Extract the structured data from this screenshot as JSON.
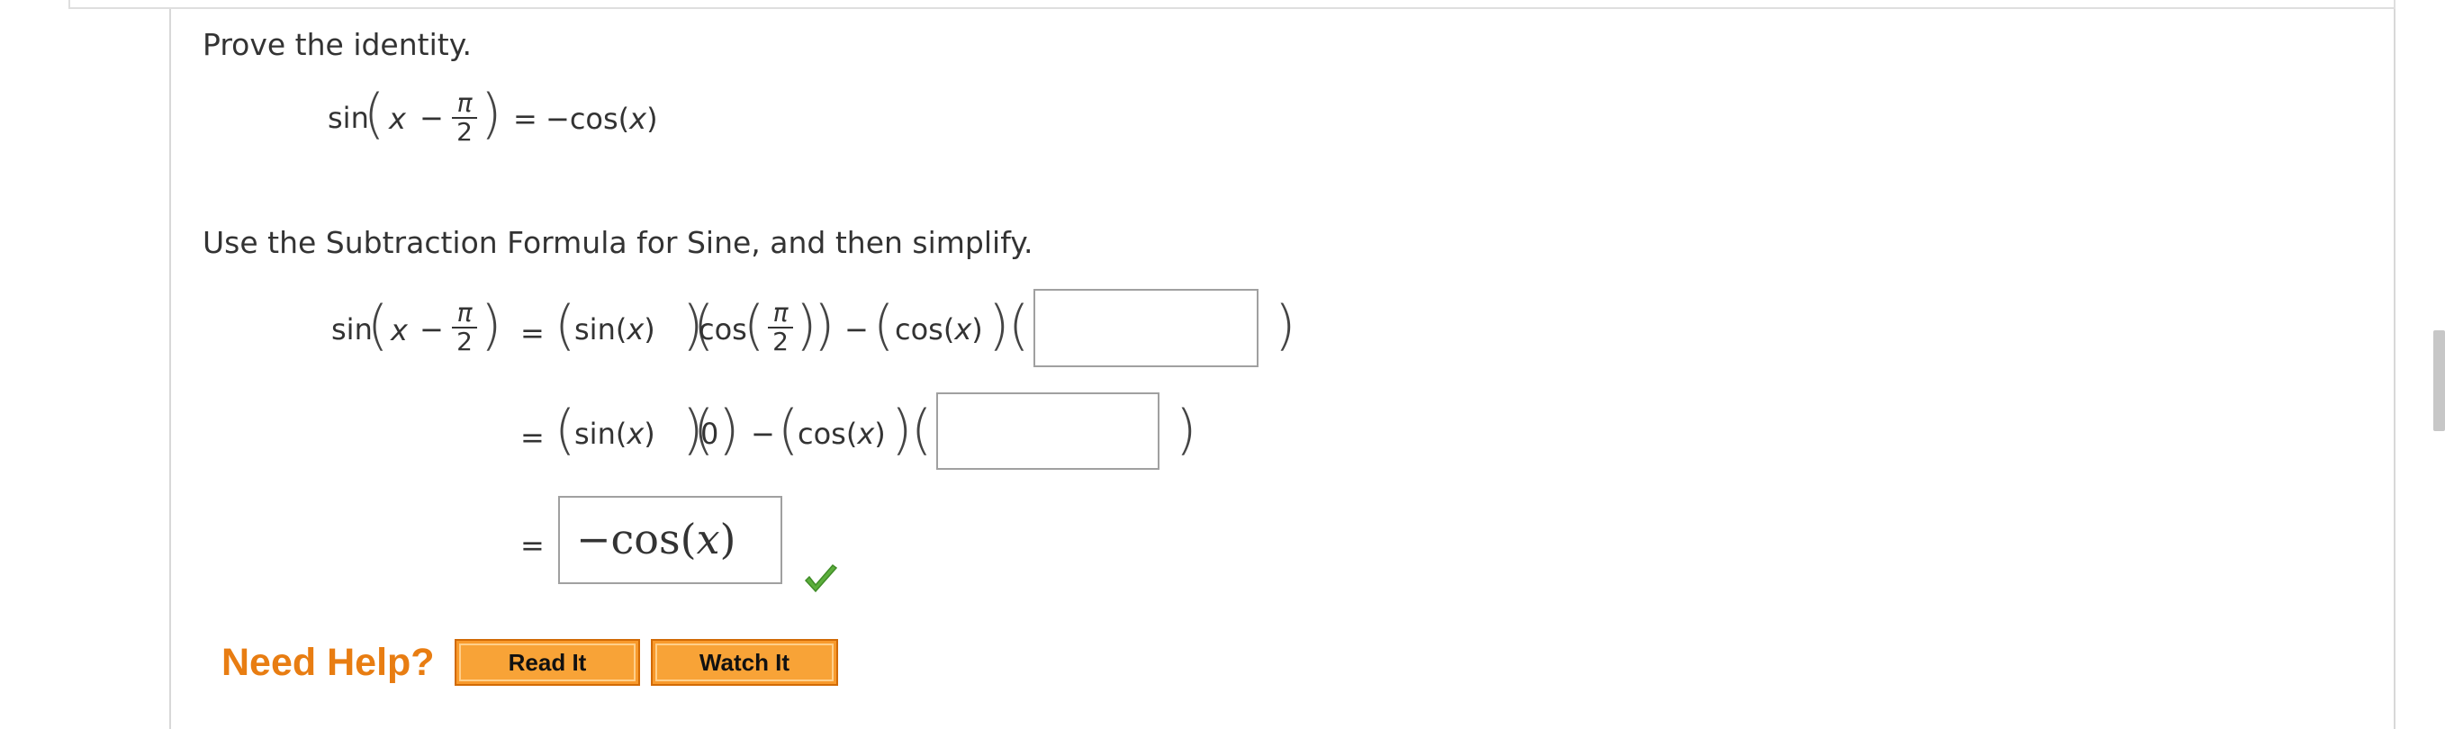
{
  "instruction": "Prove the identity.",
  "identity": {
    "sin": "sin",
    "x": "x",
    "minus": "−",
    "pi": "π",
    "two": "2",
    "equals": "=",
    "rhs_prefix": "−cos(",
    "rhs_x": "x",
    "rhs_suffix": ")"
  },
  "step_instruction": "Use the Subtraction Formula for Sine, and then simplify.",
  "line1": {
    "sin": "sin",
    "x": "x",
    "minus": "−",
    "pi": "π",
    "two": "2",
    "equals": "=",
    "sin_x_prefix": "sin(",
    "sin_x_var": "x",
    "sin_x_suffix": ")",
    "cos": "cos",
    "minus2": "−",
    "cos_x_prefix": "cos(",
    "cos_x_var": "x",
    "cos_x_suffix": ")",
    "input_value": ""
  },
  "line2": {
    "equals": "=",
    "sin_x_prefix": "sin(",
    "sin_x_var": "x",
    "sin_x_suffix": ")",
    "zero": "0",
    "minus": "−",
    "cos_x_prefix": "cos(",
    "cos_x_var": "x",
    "cos_x_suffix": ")",
    "input_value": ""
  },
  "line3": {
    "equals": "=",
    "answer_prefix": "−cos",
    "answer_open": "(",
    "answer_var": "x",
    "answer_close": ")",
    "status": "correct"
  },
  "help": {
    "label": "Need Help?",
    "read_it": "Read It",
    "watch_it": "Watch It"
  },
  "colors": {
    "help_orange": "#e87d12",
    "button_orange": "#f8a337",
    "check_green": "#5cae3c"
  }
}
